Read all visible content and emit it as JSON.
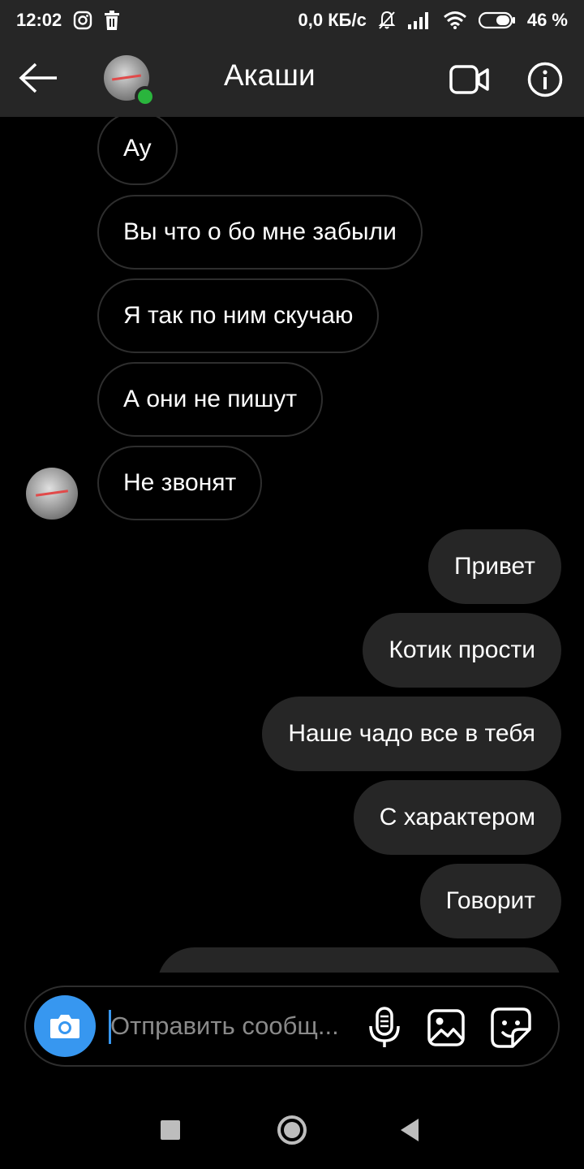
{
  "status_bar": {
    "time": "12:02",
    "network_speed": "0,0 КБ/с",
    "battery": "46 %",
    "icons": [
      "instagram-icon",
      "trash-icon",
      "mute-bell-icon",
      "signal-icon",
      "wifi-icon",
      "battery-icon"
    ]
  },
  "header": {
    "title": "Акаши",
    "online": true,
    "icons": [
      "back-arrow-icon",
      "avatar",
      "video-call-icon",
      "info-icon"
    ]
  },
  "messages": [
    {
      "direction": "incoming",
      "text": "Ау"
    },
    {
      "direction": "incoming",
      "text": "Вы что о бо мне забыли"
    },
    {
      "direction": "incoming",
      "text": "Я так по ним скучаю"
    },
    {
      "direction": "incoming",
      "text": "А они не пишут"
    },
    {
      "direction": "incoming",
      "text": "Не звонят"
    },
    {
      "direction": "outgoing",
      "text": "Привет"
    },
    {
      "direction": "outgoing",
      "text": "Котик прости"
    },
    {
      "direction": "outgoing",
      "text": "Наше чадо все в тебя"
    },
    {
      "direction": "outgoing",
      "text": "С характером"
    },
    {
      "direction": "outgoing",
      "text": "Говорит"
    },
    {
      "direction": "outgoing",
      "text": ""
    }
  ],
  "composer": {
    "placeholder": "Отправить сообщ...",
    "value": "",
    "icons": [
      "camera-icon",
      "microphone-icon",
      "gallery-icon",
      "sticker-icon"
    ]
  },
  "colors": {
    "bar_background": "#262626",
    "accent_blue": "#3797f0",
    "online_green": "#2ab53d",
    "outgoing_bubble": "#262626",
    "incoming_border": "#2e2e2e"
  },
  "nav_bar": {
    "icons": [
      "recents-square-icon",
      "home-circle-icon",
      "back-triangle-icon"
    ]
  }
}
